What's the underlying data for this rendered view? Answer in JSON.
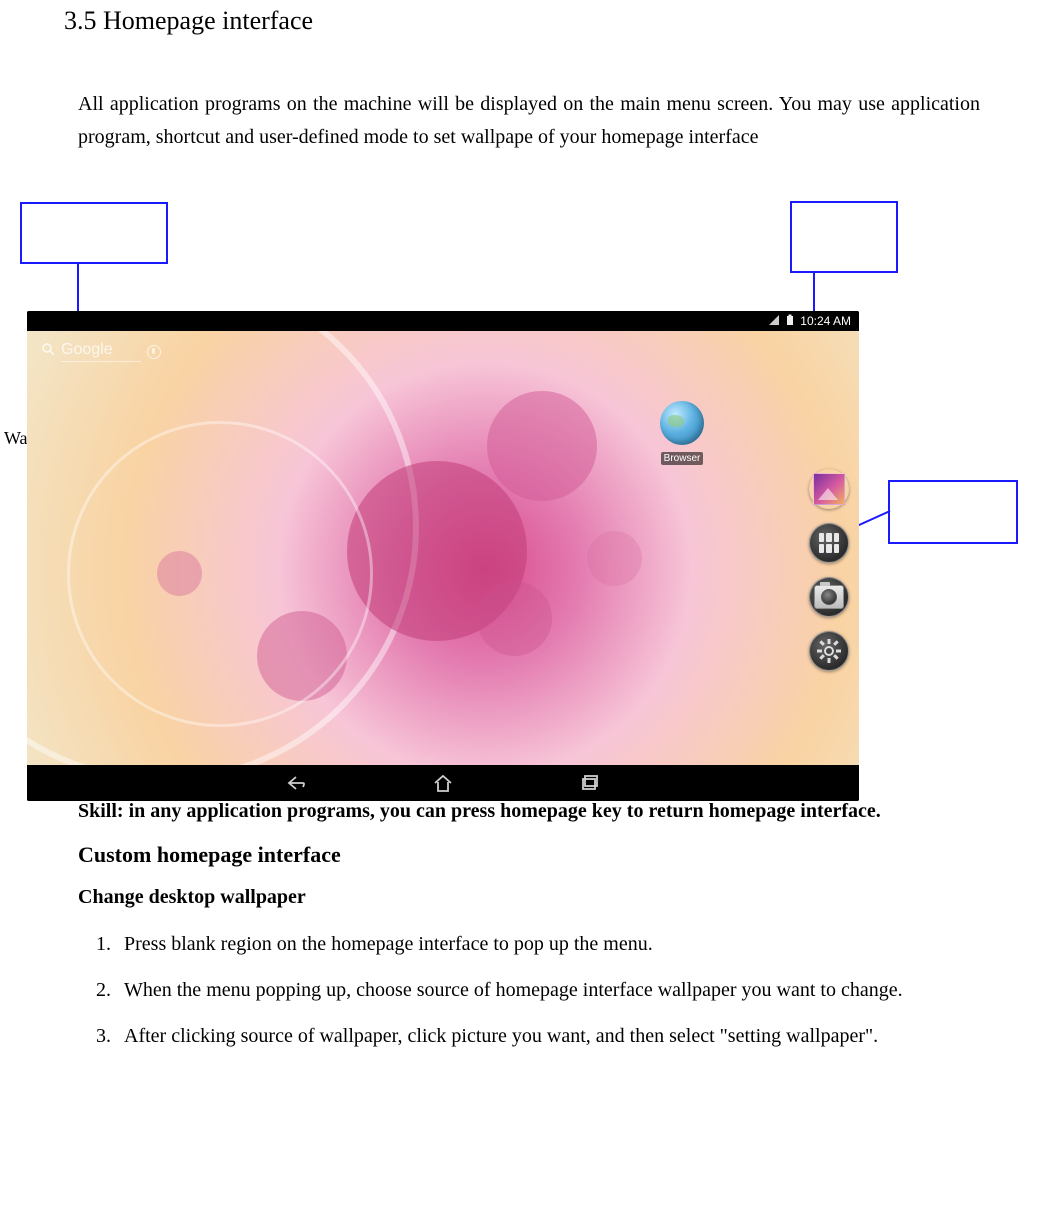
{
  "section_title": "3.5 Homepage interface",
  "intro": "All application programs on the machine will be displayed on the main menu screen. You may use application program, shortcut and user-defined mode to set wallpape of your homepage interface",
  "wallpaper_label": "Wallpaper",
  "screenshot": {
    "statusbar": {
      "time": "10:24 AM"
    },
    "google_widget": {
      "text": "Google"
    },
    "browser_app": {
      "label": "Browser"
    },
    "dock": {
      "gallery": "Gallery",
      "apps": "Apps",
      "camera": "Camera",
      "settings": "Settings"
    },
    "navbar": {
      "back": "Back",
      "home": "Home",
      "recent": "Recent"
    }
  },
  "skill_text": "Skill: in any application programs, you can press homepage key to return homepage interface.",
  "custom_heading": "Custom homepage interface",
  "change_heading": "Change desktop wallpaper",
  "steps": [
    "Press blank region on the homepage interface to pop up the menu.",
    "When the menu popping up, choose source of homepage interface wallpaper you want to change.",
    "After clicking source of wallpaper, click picture you want, and then select \"setting wallpaper\"."
  ]
}
